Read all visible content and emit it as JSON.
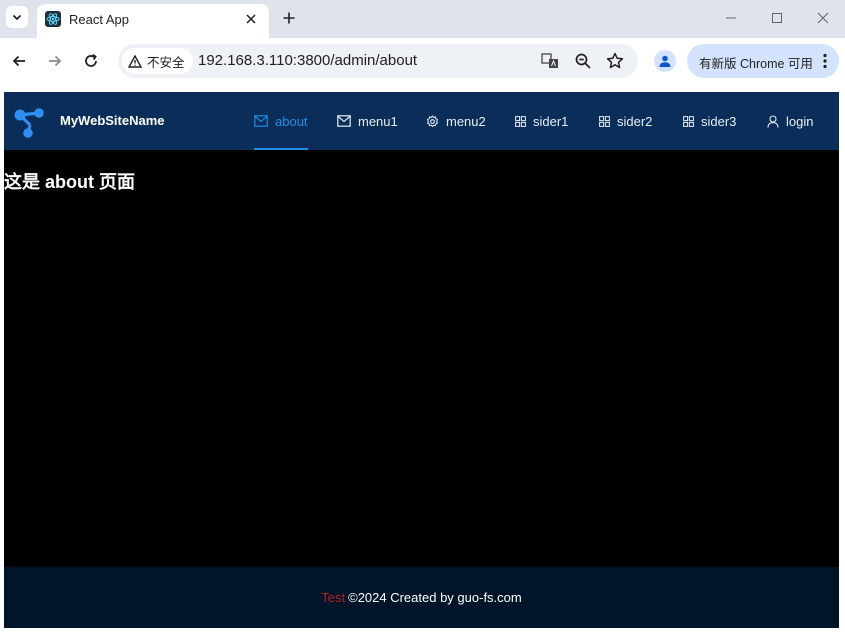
{
  "browser": {
    "tab_title": "React App",
    "security_label": "不安全",
    "url": "192.168.3.110:3800/admin/about",
    "update_label": "有新版 Chrome 可用"
  },
  "site": {
    "name": "MyWebSiteName",
    "menu": [
      {
        "label": "about",
        "icon": "mail-icon",
        "active": true
      },
      {
        "label": "menu1",
        "icon": "mail-icon",
        "active": false
      },
      {
        "label": "menu2",
        "icon": "gear-icon",
        "active": false
      },
      {
        "label": "sider1",
        "icon": "grid-icon",
        "active": false
      },
      {
        "label": "sider2",
        "icon": "grid-icon",
        "active": false
      },
      {
        "label": "sider3",
        "icon": "grid-icon",
        "active": false
      },
      {
        "label": "login",
        "icon": "user-icon",
        "active": false
      }
    ],
    "heading": "这是 about 页面",
    "footer_test": "Test",
    "footer_text": "©2024 Created by guo-fs.com"
  },
  "colors": {
    "header_bg": "#0a2e59",
    "accent": "#1d8ee6",
    "footer_bg": "#001529",
    "footer_test": "#b3212b"
  }
}
